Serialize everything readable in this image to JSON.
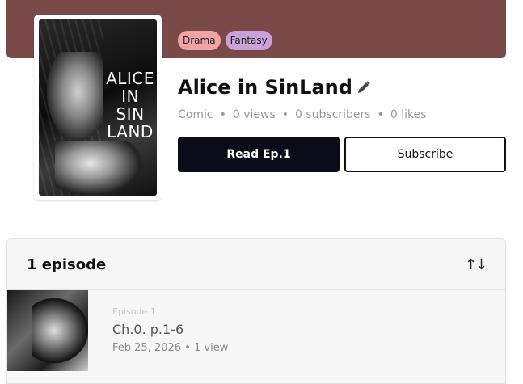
{
  "series": {
    "tags": [
      "Drama",
      "Fantasy"
    ],
    "title": "Alice in SinLand",
    "cover_text": "ALICE\nIN\nSIN\nLAND",
    "meta": {
      "type": "Comic",
      "views": "0 views",
      "subscribers": "0 subscribers",
      "likes": "0 likes"
    }
  },
  "actions": {
    "read_label": "Read Ep.1",
    "subscribe_label": "Subscribe"
  },
  "episodes": {
    "count_label": "1 episode",
    "items": [
      {
        "number": "Episode 1",
        "title": "Ch.0. p.1-6",
        "date": "Feb 25, 2026",
        "views": "1 view"
      }
    ]
  },
  "colors": {
    "banner": "#7a4a49",
    "tag_drama": "#f3a3a3",
    "tag_fantasy": "#c9a3d8",
    "primary_button": "#0c0b1a"
  }
}
